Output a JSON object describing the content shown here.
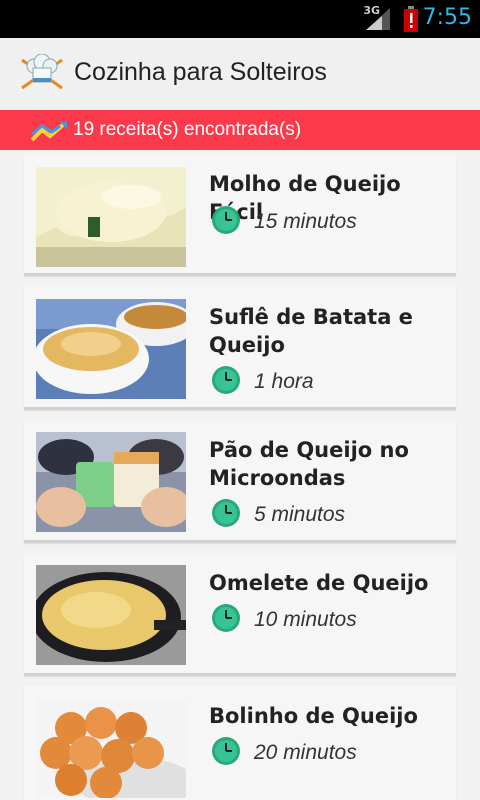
{
  "status_bar": {
    "network": "3G",
    "time": "7:55",
    "accent_color": "#33b5e5"
  },
  "action_bar": {
    "icon": "chef-hat-icon",
    "title": "Cozinha para Solteiros"
  },
  "banner": {
    "icon": "trend-arrow-icon",
    "text": "19 receita(s) encontrada(s)",
    "color": "#fa3a4a"
  },
  "recipes": [
    {
      "title": "Molho de Queijo Fácil",
      "time": "15 minutos"
    },
    {
      "title": "Suflê de Batata e Queijo",
      "time": "1 hora"
    },
    {
      "title": "Pão de Queijo no Microondas",
      "time": "5 minutos"
    },
    {
      "title": "Omelete de Queijo",
      "time": "10 minutos"
    },
    {
      "title": "Bolinho de Queijo",
      "time": "20 minutos"
    }
  ]
}
